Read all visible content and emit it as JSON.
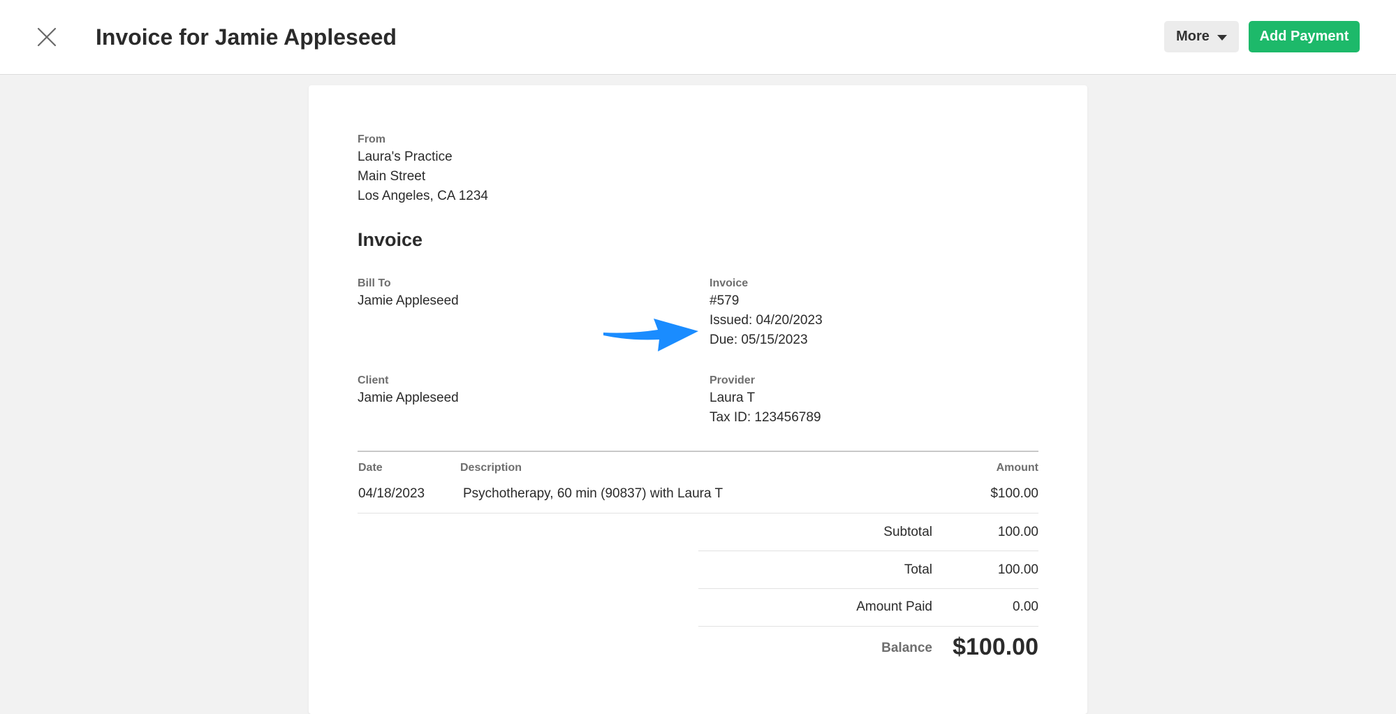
{
  "header": {
    "title": "Invoice for Jamie Appleseed",
    "more_label": "More",
    "add_payment_label": "Add Payment"
  },
  "from": {
    "label": "From",
    "name": "Laura's Practice",
    "street": "Main Street",
    "city": "Los Angeles, CA 1234"
  },
  "invoice_heading": "Invoice",
  "bill_to": {
    "label": "Bill To",
    "name": "Jamie Appleseed"
  },
  "invoice_info": {
    "label": "Invoice",
    "number": "#579",
    "issued": "Issued: 04/20/2023",
    "due": "Due: 05/15/2023"
  },
  "client": {
    "label": "Client",
    "name": "Jamie Appleseed"
  },
  "provider": {
    "label": "Provider",
    "name": "Laura T",
    "tax_id": "Tax ID: 123456789"
  },
  "table": {
    "headers": {
      "date": "Date",
      "description": "Description",
      "amount": "Amount"
    },
    "rows": [
      {
        "date": "04/18/2023",
        "description": "Psychotherapy, 60 min (90837) with Laura T",
        "amount": "$100.00"
      }
    ]
  },
  "totals": {
    "subtotal_label": "Subtotal",
    "subtotal_value": "100.00",
    "total_label": "Total",
    "total_value": "100.00",
    "amount_paid_label": "Amount Paid",
    "amount_paid_value": "0.00",
    "balance_label": "Balance",
    "balance_value": "$100.00"
  },
  "colors": {
    "accent_green": "#1db96a",
    "annotation_arrow": "#1a8cff"
  },
  "icons": {
    "close": "close-icon",
    "caret": "caret-down-icon",
    "annotation": "arrow-right-icon"
  }
}
